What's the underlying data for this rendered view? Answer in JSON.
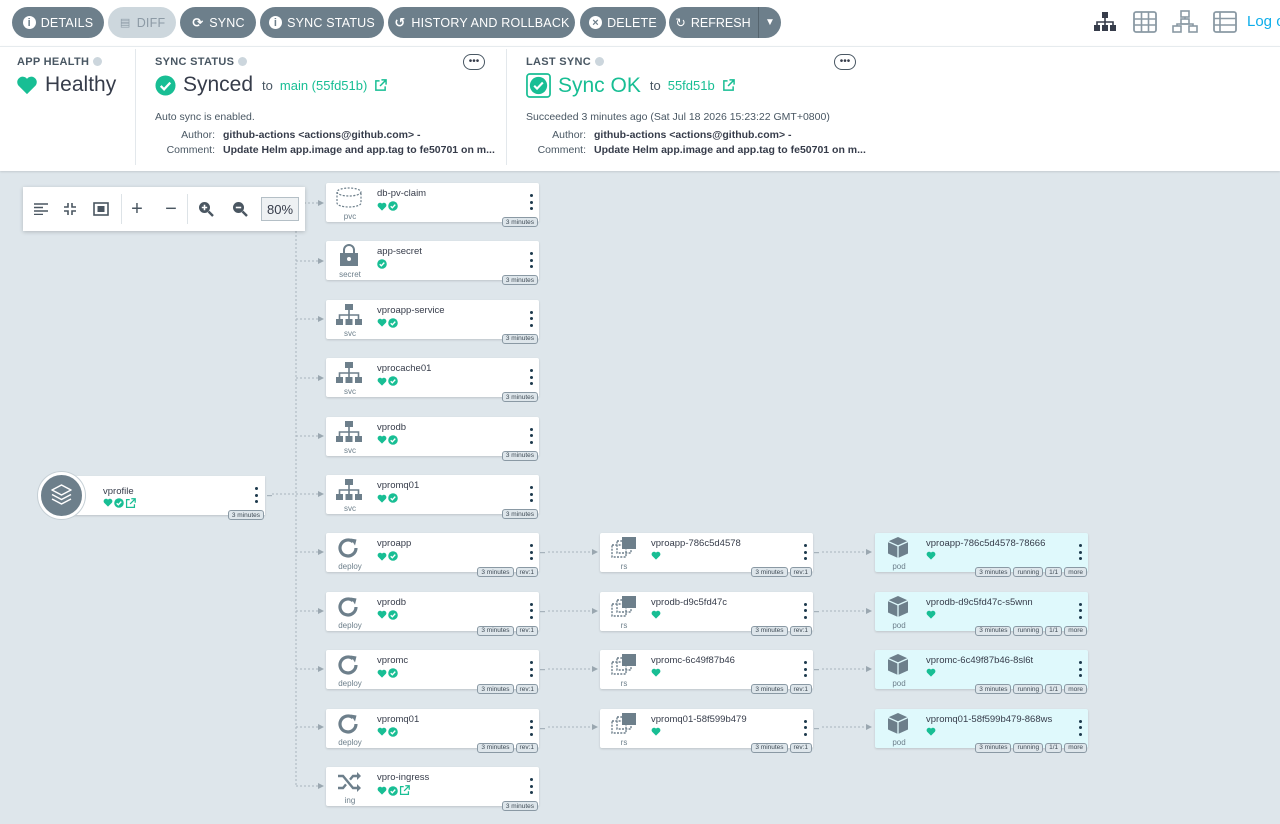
{
  "toolbar": {
    "buttons": [
      {
        "label": "DETAILS",
        "icon": "info-icon"
      },
      {
        "label": "DIFF",
        "icon": "file-diff-icon"
      },
      {
        "label": "SYNC",
        "icon": "sync-icon"
      },
      {
        "label": "SYNC STATUS",
        "icon": "info-icon"
      },
      {
        "label": "HISTORY AND ROLLBACK",
        "icon": "history-icon"
      },
      {
        "label": "DELETE",
        "icon": "times-circle-icon"
      },
      {
        "label": "REFRESH",
        "icon": "redo-icon"
      }
    ],
    "logout": "Log o"
  },
  "status": {
    "app_health": {
      "title": "APP HEALTH",
      "value": "Healthy"
    },
    "sync_status": {
      "title": "SYNC STATUS",
      "value": "Synced",
      "to": "to",
      "revision": "main (55fd51b)",
      "auto_sync": "Auto sync is enabled.",
      "author_label": "Author:",
      "author": "github-actions <actions@github.com> -",
      "comment_label": "Comment:",
      "comment": "Update Helm app.image and app.tag to fe50701 on m..."
    },
    "last_sync": {
      "title": "LAST SYNC",
      "value": "Sync OK",
      "to": "to",
      "revision": "55fd51b",
      "succeeded": "Succeeded 3 minutes ago (Sat Jul 18 2026 15:23:22 GMT+0800)",
      "author_label": "Author:",
      "author": "github-actions <actions@github.com> -",
      "comment_label": "Comment:",
      "comment": "Update Helm app.image and app.tag to fe50701 on m..."
    }
  },
  "graph": {
    "zoom": "80%",
    "app": {
      "name": "vprofile",
      "age": "3 minutes"
    },
    "resources": [
      {
        "name": "db-pv-claim",
        "kind": "pvc",
        "age": "3 minutes"
      },
      {
        "name": "app-secret",
        "kind": "secret",
        "age": "3 minutes"
      },
      {
        "name": "vproapp-service",
        "kind": "svc",
        "age": "3 minutes"
      },
      {
        "name": "vprocache01",
        "kind": "svc",
        "age": "3 minutes"
      },
      {
        "name": "vprodb",
        "kind": "svc",
        "age": "3 minutes"
      },
      {
        "name": "vpromq01",
        "kind": "svc",
        "age": "3 minutes"
      },
      {
        "name": "vproapp",
        "kind": "deploy",
        "age": "3 minutes",
        "rev": "rev:1"
      },
      {
        "name": "vprodb",
        "kind": "deploy",
        "age": "3 minutes",
        "rev": "rev:1"
      },
      {
        "name": "vpromc",
        "kind": "deploy",
        "age": "3 minutes",
        "rev": "rev:1"
      },
      {
        "name": "vpromq01",
        "kind": "deploy",
        "age": "3 minutes",
        "rev": "rev:1"
      },
      {
        "name": "vpro-ingress",
        "kind": "ing",
        "age": "3 minutes"
      }
    ],
    "replicasets": [
      {
        "name": "vproapp-786c5d4578",
        "kind": "rs",
        "age": "3 minutes",
        "rev": "rev:1"
      },
      {
        "name": "vprodb-d9c5fd47c",
        "kind": "rs",
        "age": "3 minutes",
        "rev": "rev:1"
      },
      {
        "name": "vpromc-6c49f87b46",
        "kind": "rs",
        "age": "3 minutes",
        "rev": "rev:1"
      },
      {
        "name": "vpromq01-58f599b479",
        "kind": "rs",
        "age": "3 minutes",
        "rev": "rev:1"
      }
    ],
    "pods": [
      {
        "name": "vproapp-786c5d4578-78666",
        "kind": "pod",
        "age": "3 minutes",
        "status": "running",
        "ready": "1/1",
        "more": "more"
      },
      {
        "name": "vprodb-d9c5fd47c-s5wnn",
        "kind": "pod",
        "age": "3 minutes",
        "status": "running",
        "ready": "1/1",
        "more": "more"
      },
      {
        "name": "vpromc-6c49f87b46-8sl6t",
        "kind": "pod",
        "age": "3 minutes",
        "status": "running",
        "ready": "1/1",
        "more": "more"
      },
      {
        "name": "vpromq01-58f599b479-868ws",
        "kind": "pod",
        "age": "3 minutes",
        "status": "running",
        "ready": "1/1",
        "more": "more"
      }
    ]
  },
  "colors": {
    "healthy": "#18be94",
    "toolbar_button": "#6d7f8b",
    "link": "#0dadea",
    "pod_bg": "#dff9fc"
  }
}
